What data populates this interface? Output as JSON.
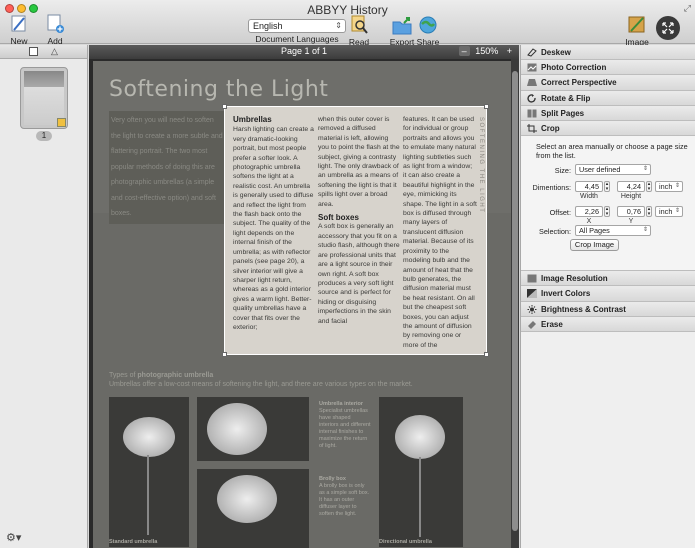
{
  "window": {
    "title": "ABBYY History"
  },
  "toolbar": {
    "new_task": "New Task",
    "add_pages": "Add Pages",
    "language_value": "English",
    "language_label": "Document Languages",
    "read": "Read",
    "export": "Export",
    "share": "Share",
    "image_editor": "Image Editor"
  },
  "thumbnails": {
    "page_number": "1"
  },
  "docview": {
    "page_label": "Page 1 of 1",
    "zoom_minus": "–",
    "zoom_value": "150%",
    "zoom_plus": "+"
  },
  "document": {
    "title": "Softening the Light",
    "left_column": "Very often you will need to soften the light to create a more subtle and flattering portrait. The two most popular methods of doing this are photographic umbrellas (a simple and cost-effective option) and soft boxes.",
    "col1_heading": "Umbrellas",
    "col1_text": "Harsh lighting can create a very dramatic-looking portrait, but most people prefer a softer look. A photographic umbrella softens the light at a realistic cost. An umbrella is generally used to diffuse and reflect the light from the flash back onto the subject. The quality of the light depends on the internal finish of the umbrella; as with reflector panels (see page 20), a silver interior will give a sharper light return, whereas as a gold interior gives a warm light. Better-quality umbrellas have a cover that fits over the exterior;",
    "col2_text": "when this outer cover is removed a diffused material is left, allowing you to point the flash at the subject, giving a contrasty light. The only drawback of an umbrella as a means of softening the light is that it spills light over a broad area.",
    "col2_heading": "Soft boxes",
    "col2_text2": "A soft box is generally an accessory that you fit on a studio flash, although there are professional units that are a light source in their own right. A soft box produces a very soft light source and is perfect for hiding or disguising imperfections in the skin and facial",
    "col3_text": "features. It can be used for individual or group portraits and allows you to emulate many natural lighting subtleties such as light from a window; it can also create a beautiful highlight in the eye, mimicking its shape. The light in a soft box is diffused through many layers of translucent diffusion material. Because of its proximity to the modeling bulb and the amount of heat that the bulb generates, the diffusion material must be heat resistant. On all but the cheapest soft boxes, you can adjust the amount of diffusion by removing one or more of the",
    "vertical_caption": "SOFTENING THE LIGHT",
    "lower_title_a": "Types of ",
    "lower_title_b": "photographic umbrella",
    "lower_sub": "Umbrellas offer a low-cost means of softening the light, and there are various types on the market.",
    "cap_interior_head": "Umbrella interior",
    "cap_interior": "Specialist umbrellas have shaped interiors and different internal finishes to maximize the return of light.",
    "cap_brolly_head": "Brolly box",
    "cap_brolly": "A brolly box is only as a simple soft box. It has an outer diffuser layer to soften the light.",
    "cap_directional": "Directional umbrella",
    "cap_standard": "Standard umbrella"
  },
  "panel": {
    "deskew": "Deskew",
    "photo_correction": "Photo Correction",
    "correct_perspective": "Correct Perspective",
    "rotate_flip": "Rotate & Flip",
    "split_pages": "Split Pages",
    "crop": "Crop",
    "crop_desc": "Select an area manually or choose a page size from the list.",
    "size_label": "Size:",
    "size_value": "User defined",
    "dimentions_label": "Dimentions:",
    "width_value": "4,45",
    "height_value": "4,24",
    "dim_unit": "inch",
    "width_label": "Width",
    "height_label": "Height",
    "offset_label": "Offset:",
    "x_value": "2,26",
    "y_value": "0,76",
    "offset_unit": "inch",
    "x_label": "X",
    "y_label": "Y",
    "selection_label": "Selection:",
    "selection_value": "All Pages",
    "crop_button": "Crop Image",
    "image_resolution": "Image Resolution",
    "invert_colors": "Invert Colors",
    "brightness_contrast": "Brightness & Contrast",
    "erase": "Erase"
  },
  "colors": {
    "close": "#ff5f57",
    "minimize": "#febc2e",
    "zoom": "#28c840"
  }
}
